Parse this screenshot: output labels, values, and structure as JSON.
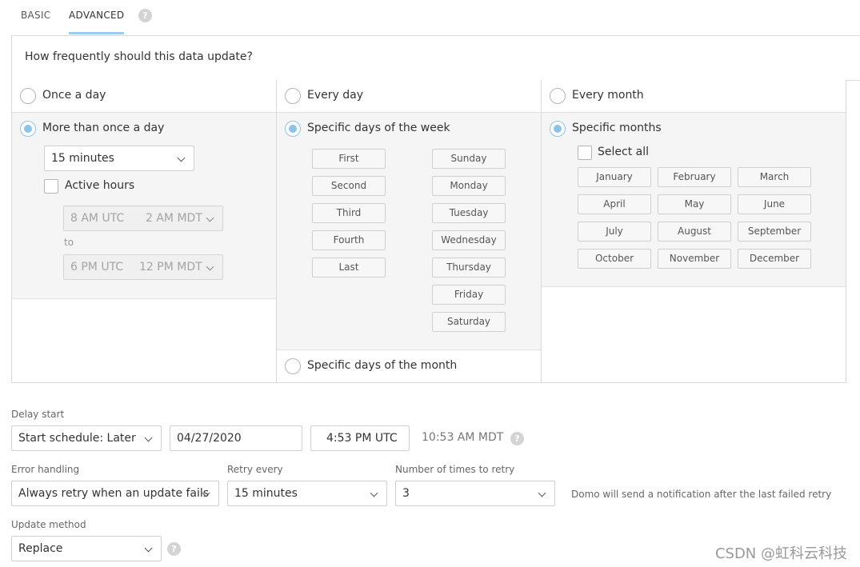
{
  "tabs": [
    {
      "label": "BASIC",
      "active": false
    },
    {
      "label": "ADVANCED",
      "active": true
    }
  ],
  "help_icon": "?",
  "question": "How frequently should this data update?",
  "column1": {
    "option_once": "Once a day",
    "option_more": "More than once a day",
    "interval_value": "15 minutes",
    "active_hours_label": "Active hours",
    "start_utc": "8 AM UTC",
    "start_local": "2 AM MDT",
    "to_label": "to",
    "end_utc": "6 PM UTC",
    "end_local": "12 PM MDT"
  },
  "column2": {
    "option_every_day": "Every day",
    "option_week": "Specific days of the week",
    "ordinals": [
      "First",
      "Second",
      "Third",
      "Fourth",
      "Last"
    ],
    "weekdays": [
      "Sunday",
      "Monday",
      "Tuesday",
      "Wednesday",
      "Thursday",
      "Friday",
      "Saturday"
    ],
    "option_month": "Specific days of the month"
  },
  "column3": {
    "option_every_month": "Every month",
    "option_specific": "Specific months",
    "select_all": "Select all",
    "months": [
      "January",
      "February",
      "March",
      "April",
      "May",
      "June",
      "July",
      "August",
      "September",
      "October",
      "November",
      "December"
    ]
  },
  "delay": {
    "label": "Delay start",
    "schedule_value": "Start schedule: Later",
    "date_value": "04/27/2020",
    "time_value": "4:53 PM UTC",
    "local_time": "10:53 AM MDT"
  },
  "error_handling": {
    "label": "Error handling",
    "value": "Always retry when an update fails",
    "retry_label": "Retry every",
    "retry_value": "15 minutes",
    "times_label": "Number of times to retry",
    "times_value": "3",
    "note": "Domo will send a notification after the last failed retry"
  },
  "update_method": {
    "label": "Update method",
    "value": "Replace"
  },
  "watermark": "CSDN @虹科云科技",
  "colors": {
    "accent": "#8cc3ea",
    "tab_underline": "#99ccee",
    "panel": "#f5f5f5",
    "border": "#d9d9d9"
  }
}
